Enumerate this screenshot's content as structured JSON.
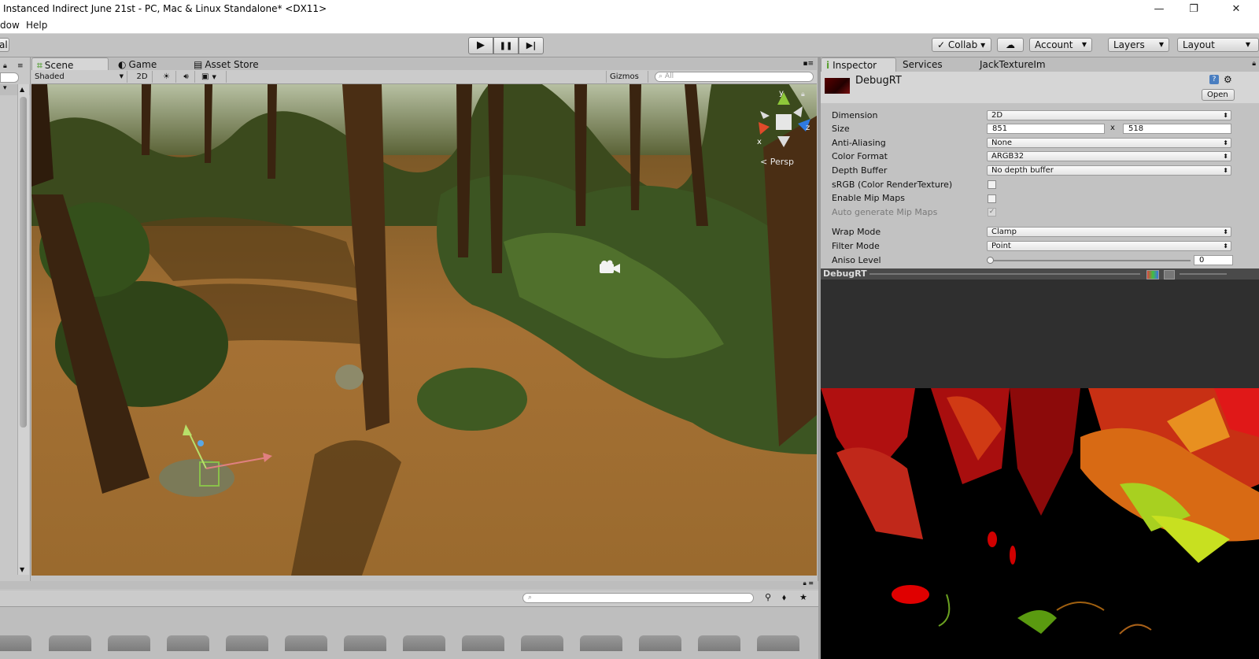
{
  "window": {
    "title": "Instanced Indirect June 21st - PC, Mac & Linux Standalone* <DX11>",
    "controls": [
      "—",
      "❐",
      "✕"
    ]
  },
  "menu": {
    "items": [
      "dow",
      "Help"
    ]
  },
  "toolbar": {
    "left_label": "al",
    "play_icons": [
      "▶",
      "❚❚",
      "▶|"
    ],
    "collab": "Collab ▾",
    "account": "Account",
    "layers": "Layers",
    "layout": "Layout"
  },
  "scene_tabs": [
    "Scene",
    "Game",
    "Asset Store"
  ],
  "scene_toolbar": {
    "shading": "Shaded",
    "mode_2d": "2D",
    "gizmos": "Gizmos",
    "search_placeholder": "All"
  },
  "viewport": {
    "persp_label": "< Persp",
    "axis_labels": [
      "y",
      "x",
      "z"
    ]
  },
  "inspector": {
    "tabs": [
      "Inspector",
      "Services",
      "JackTextureIm"
    ],
    "asset_name": "DebugRT",
    "open_button": "Open",
    "properties": [
      {
        "label": "Dimension",
        "value": "2D",
        "kind": "dropdown"
      },
      {
        "label": "Size",
        "kind": "size",
        "w": "851",
        "x": "x",
        "h": "518"
      },
      {
        "label": "Anti-Aliasing",
        "value": "None",
        "kind": "dropdown"
      },
      {
        "label": "Color Format",
        "value": "ARGB32",
        "kind": "dropdown"
      },
      {
        "label": "Depth Buffer",
        "value": "No depth buffer",
        "kind": "dropdown"
      },
      {
        "label": "sRGB (Color RenderTexture)",
        "kind": "checkbox",
        "checked": false
      },
      {
        "label": "Enable Mip Maps",
        "kind": "checkbox",
        "checked": false
      },
      {
        "label": "Auto generate Mip Maps",
        "kind": "checkbox",
        "checked": true,
        "disabled": true
      },
      {
        "label": "Wrap Mode",
        "value": "Clamp",
        "kind": "dropdown"
      },
      {
        "label": "Filter Mode",
        "value": "Point",
        "kind": "dropdown"
      },
      {
        "label": "Aniso Level",
        "kind": "slider",
        "value": "0"
      }
    ],
    "preview_title": "DebugRT"
  },
  "colors": {
    "accent": "#4a9adf",
    "panel": "#c2c2c2",
    "dark": "#2f2f2f"
  }
}
